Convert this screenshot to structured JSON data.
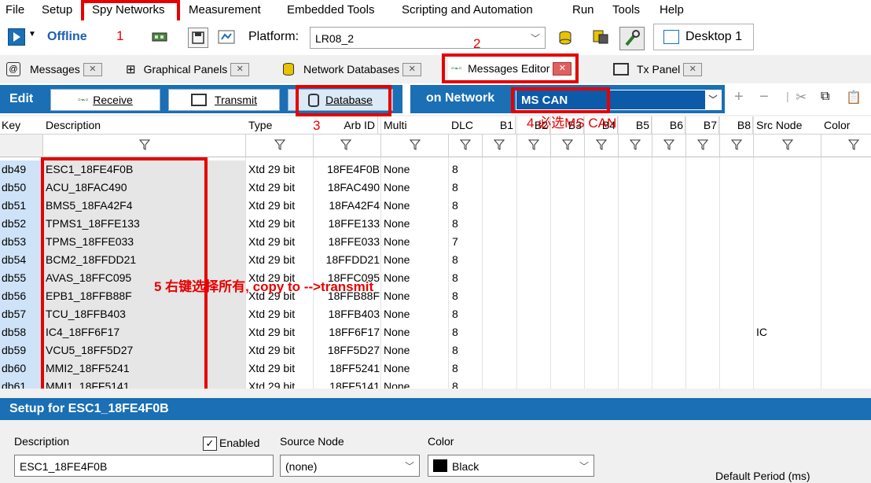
{
  "menu": [
    "File",
    "Setup",
    "Spy Networks",
    "Measurement",
    "Embedded Tools",
    "Scripting and Automation",
    "Run",
    "Tools",
    "Help"
  ],
  "toolbar": {
    "status": "Offline",
    "platform_label": "Platform:",
    "platform_value": "LR08_2",
    "desktop_tab": "Desktop 1"
  },
  "tabs": [
    "Messages",
    "Graphical Panels",
    "Network Databases",
    "Messages Editor",
    "Tx Panel"
  ],
  "editbar": {
    "edit": "Edit",
    "receive": "Receive",
    "transmit": "Transmit",
    "database": "Database",
    "on_network": "on Network",
    "network_value": "MS CAN"
  },
  "columns": [
    "Key",
    "Description",
    "Type",
    "Arb ID",
    "Multi",
    "DLC",
    "B1",
    "B2",
    "B3",
    "B4",
    "B5",
    "B6",
    "B7",
    "B8",
    "Src Node",
    "Color"
  ],
  "rows": [
    {
      "key": "db49",
      "desc": "ESC1_18FE4F0B",
      "type": "Xtd 29 bit",
      "arb": "18FE4F0B",
      "multi": "None",
      "dlc": "8",
      "src": ""
    },
    {
      "key": "db50",
      "desc": "ACU_18FAC490",
      "type": "Xtd 29 bit",
      "arb": "18FAC490",
      "multi": "None",
      "dlc": "8",
      "src": ""
    },
    {
      "key": "db51",
      "desc": "BMS5_18FA42F4",
      "type": "Xtd 29 bit",
      "arb": "18FA42F4",
      "multi": "None",
      "dlc": "8",
      "src": ""
    },
    {
      "key": "db52",
      "desc": "TPMS1_18FFE133",
      "type": "Xtd 29 bit",
      "arb": "18FFE133",
      "multi": "None",
      "dlc": "8",
      "src": ""
    },
    {
      "key": "db53",
      "desc": "TPMS_18FFE033",
      "type": "Xtd 29 bit",
      "arb": "18FFE033",
      "multi": "None",
      "dlc": "7",
      "src": ""
    },
    {
      "key": "db54",
      "desc": "BCM2_18FFDD21",
      "type": "Xtd 29 bit",
      "arb": "18FFDD21",
      "multi": "None",
      "dlc": "8",
      "src": ""
    },
    {
      "key": "db55",
      "desc": "AVAS_18FFC095",
      "type": "Xtd 29 bit",
      "arb": "18FFC095",
      "multi": "None",
      "dlc": "8",
      "src": ""
    },
    {
      "key": "db56",
      "desc": "EPB1_18FFB88F",
      "type": "Xtd 29 bit",
      "arb": "18FFB88F",
      "multi": "None",
      "dlc": "8",
      "src": ""
    },
    {
      "key": "db57",
      "desc": "TCU_18FFB403",
      "type": "Xtd 29 bit",
      "arb": "18FFB403",
      "multi": "None",
      "dlc": "8",
      "src": ""
    },
    {
      "key": "db58",
      "desc": "IC4_18FF6F17",
      "type": "Xtd 29 bit",
      "arb": "18FF6F17",
      "multi": "None",
      "dlc": "8",
      "src": "IC"
    },
    {
      "key": "db59",
      "desc": "VCU5_18FF5D27",
      "type": "Xtd 29 bit",
      "arb": "18FF5D27",
      "multi": "None",
      "dlc": "8",
      "src": ""
    },
    {
      "key": "db60",
      "desc": "MMI2_18FF5241",
      "type": "Xtd 29 bit",
      "arb": "18FF5241",
      "multi": "None",
      "dlc": "8",
      "src": ""
    },
    {
      "key": "db61",
      "desc": "MMI1_18FF5141",
      "type": "Xtd 29 bit",
      "arb": "18FF5141",
      "multi": "None",
      "dlc": "8",
      "src": ""
    }
  ],
  "annotations": {
    "a1": "1",
    "a2": "2",
    "a3": "3",
    "a4": "4 必选MS CAN",
    "a5": "5 右键选择所有, copy to -->transmit"
  },
  "setup": {
    "title": "Setup for ESC1_18FE4F0B",
    "description_label": "Description",
    "description_value": "ESC1_18FE4F0B",
    "enabled_label": "Enabled",
    "source_node_label": "Source Node",
    "source_node_value": "(none)",
    "color_label": "Color",
    "color_value": "Black",
    "default_period_label": "Default Period (ms)"
  },
  "colors": {
    "accent": "#1a6fb5",
    "annotation": "#e60000",
    "key_bg": "#cfe3f8"
  }
}
